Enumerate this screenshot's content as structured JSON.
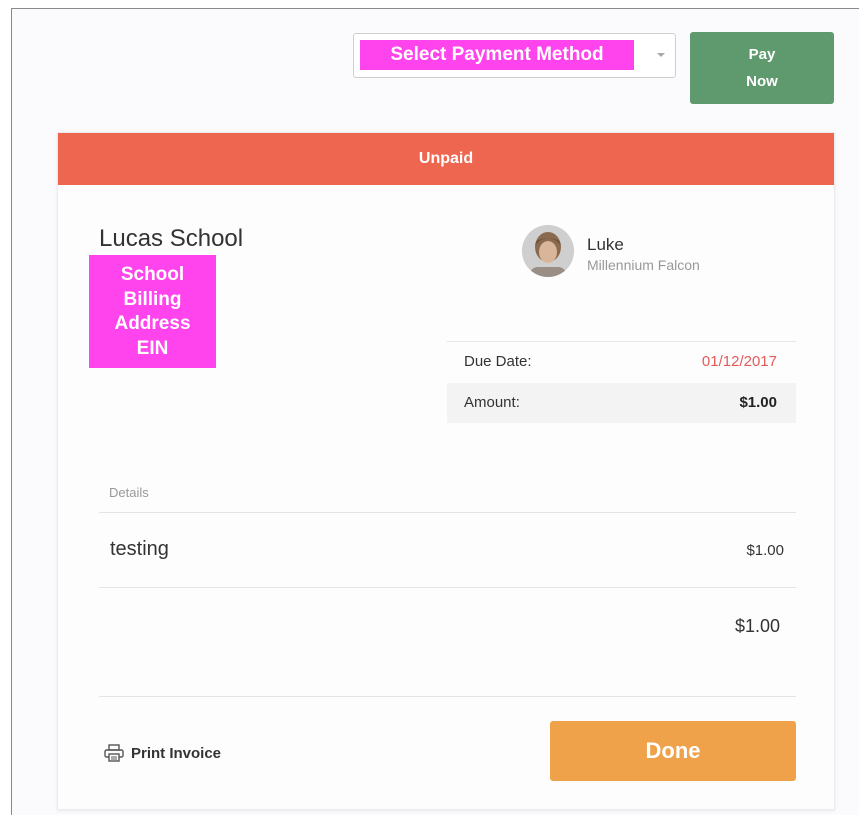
{
  "header": {
    "payment_method_placeholder": "Select Payment Method",
    "pay_button": [
      "Pay",
      "Now"
    ]
  },
  "invoice": {
    "status": "Unpaid",
    "status_color": "#ef6650",
    "school": {
      "name": "Lucas School",
      "redacted_lines": [
        "School",
        "Billing",
        "Address",
        "EIN"
      ]
    },
    "user": {
      "name": "Luke",
      "subtitle": "Millennium Falcon"
    },
    "summary": {
      "due_label": "Due Date:",
      "due_value": "01/12/2017",
      "amount_label": "Amount:",
      "amount_value": "$1.00"
    },
    "details": {
      "label": "Details",
      "items": [
        {
          "description": "testing",
          "amount": "$1.00"
        }
      ],
      "total": "$1.00"
    }
  },
  "footer": {
    "print_label": "Print Invoice",
    "done_label": "Done"
  },
  "colors": {
    "pay_button": "#5f9a6e",
    "done_button": "#f0a24a",
    "redaction": "#ff44ee",
    "due_date": "#e35a5a"
  }
}
